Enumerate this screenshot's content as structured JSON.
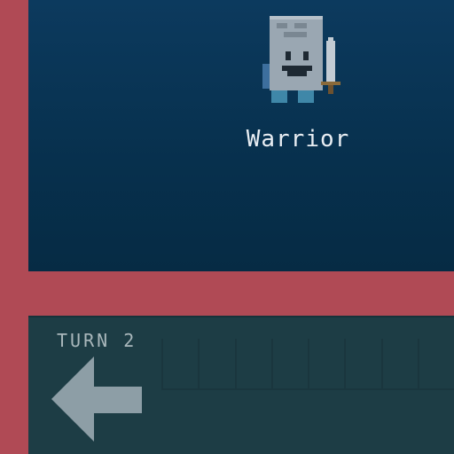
{
  "hero": {
    "name": "Warrior",
    "icon": "warrior-sprite"
  },
  "turn": {
    "label": "TURN 2"
  },
  "controls": {
    "back_icon": "left-arrow-icon"
  },
  "colors": {
    "frame": "#b04a55",
    "scene_top": "#0c3a5e",
    "scene_bottom": "#062b44",
    "turn_panel": "#1d3d45",
    "text": "#e9eef3",
    "arrow": "#8d9ea6"
  }
}
